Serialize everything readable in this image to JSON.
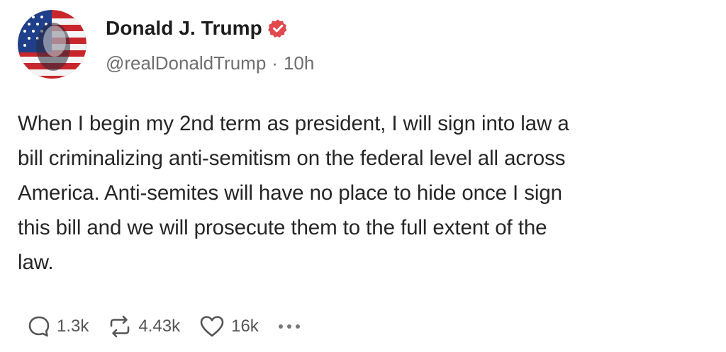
{
  "post": {
    "author": {
      "display_name": "Donald J. Trump",
      "handle": "@realDonaldTrump",
      "separator": "·",
      "time_ago": "10h",
      "verified": true,
      "avatar_icon": "flag-portrait-avatar",
      "verified_icon": "verified-badge-icon"
    },
    "text": "When I begin my 2nd term as president, I will sign into law a\nbill criminalizing anti-semitism on the federal level all across\nAmerica. Anti-semites will have no place to hide once I sign\nthis bill and we will prosecute them to the full extent of the\nlaw.",
    "actions": {
      "reply_icon": "reply-icon",
      "reply_count": "1.3k",
      "repost_icon": "repost-icon",
      "repost_count": "4.43k",
      "like_icon": "heart-icon",
      "like_count": "16k",
      "more_icon": "more-icon"
    }
  },
  "colors": {
    "verified_badge": "#e0494d",
    "text_primary": "#1c1c1c",
    "text_secondary": "#6f6f6f",
    "icon": "#555555"
  }
}
